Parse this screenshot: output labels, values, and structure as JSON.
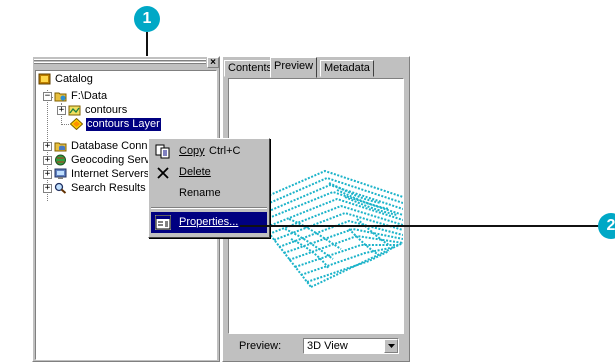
{
  "callouts": {
    "first": "1",
    "second": "2"
  },
  "tree": {
    "items": [
      {
        "label": "Catalog"
      },
      {
        "label": "F:\\Data"
      },
      {
        "label": "contours"
      },
      {
        "label": "contours Layer"
      },
      {
        "label": "Database Connec"
      },
      {
        "label": "Geocoding Servic"
      },
      {
        "label": "Internet Servers"
      },
      {
        "label": "Search Results"
      }
    ]
  },
  "tabs": [
    {
      "label": "Contents"
    },
    {
      "label": "Preview"
    },
    {
      "label": "Metadata"
    }
  ],
  "preview": {
    "label": "Preview:",
    "view": "3D View"
  },
  "context_menu": {
    "items": [
      {
        "label": "Copy",
        "shortcut": "Ctrl+C"
      },
      {
        "label": "Delete"
      },
      {
        "label": "Rename"
      },
      {
        "label": "Properties..."
      }
    ]
  },
  "colors": {
    "callout": "#00a8c6",
    "selection": "#000080",
    "surface": "#1bb3c9"
  }
}
